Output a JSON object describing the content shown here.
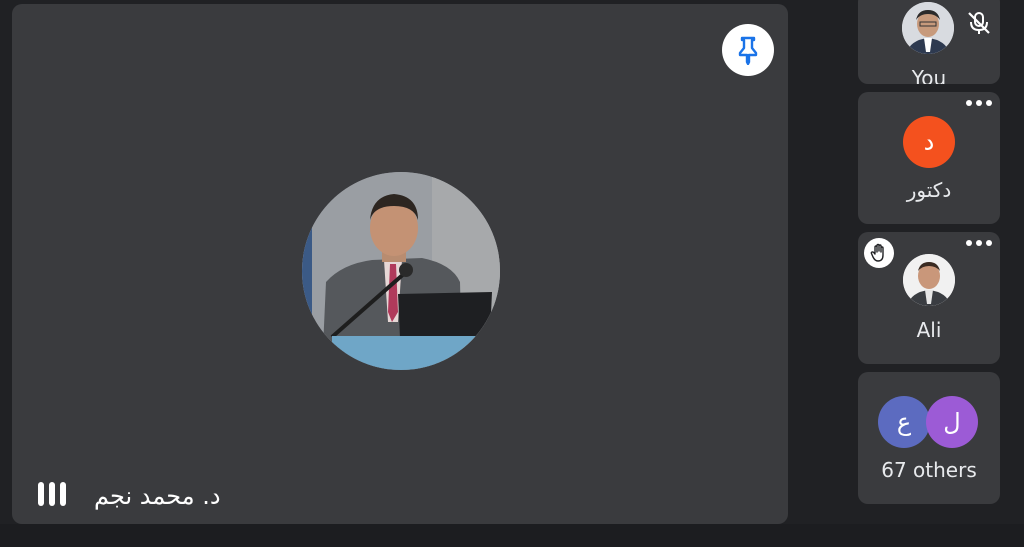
{
  "main": {
    "speaker_name": "د. محمد نجم",
    "pin_icon": "pin-icon",
    "speaking_icon": "audio-level-icon"
  },
  "sidebar": {
    "tiles": [
      {
        "label": "You",
        "avatar": "photo",
        "status_icon": "mic-off-icon"
      },
      {
        "label": "دكتور",
        "avatar_letter": "د",
        "avatar_color": "#f4511e",
        "menu_icon": "more-horiz-icon"
      },
      {
        "label": "Ali",
        "avatar": "photo",
        "badge_icon": "raised-hand-icon",
        "menu_icon": "more-horiz-icon"
      },
      {
        "label": "67 others",
        "avatar_letters": [
          "ع",
          "ل"
        ],
        "avatar_colors": [
          "#5c6bc0",
          "#9c5bd6"
        ]
      }
    ]
  },
  "colors": {
    "background": "#202124",
    "tile": "#3a3b3e",
    "accent_blue": "#1a73e8"
  }
}
